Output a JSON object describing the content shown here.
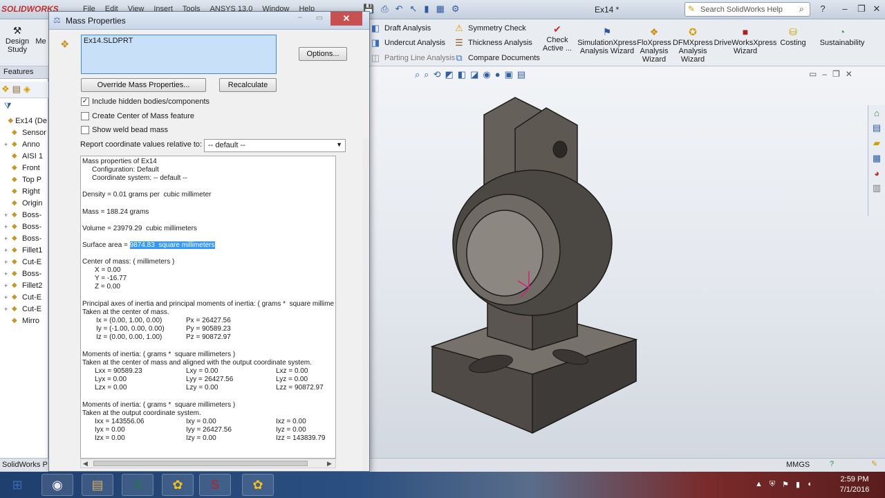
{
  "titlebar": {
    "logo": "SOLIDWORKS",
    "menus": [
      "File",
      "Edit",
      "View",
      "Insert",
      "Tools",
      "ANSYS 13.0",
      "Window",
      "Help"
    ],
    "document_title": "Ex14 *",
    "search_placeholder": "Search SolidWorks Help"
  },
  "cmdbar": {
    "design_study": "Design Study",
    "stub": "Me",
    "small_left": [
      {
        "label": "Draft Analysis",
        "icon": "draft-analysis-icon"
      },
      {
        "label": "Undercut Analysis",
        "icon": "undercut-analysis-icon"
      },
      {
        "label": "Parting Line Analysis",
        "icon": "parting-line-icon"
      }
    ],
    "small_right": [
      {
        "label": "Symmetry Check",
        "icon": "symmetry-check-icon"
      },
      {
        "label": "Thickness Analysis",
        "icon": "thickness-analysis-icon"
      },
      {
        "label": "Compare Documents",
        "icon": "compare-documents-icon"
      }
    ],
    "check_active": "Check Active ...",
    "big": [
      {
        "label": "SimulationXpress Analysis Wizard",
        "icon": "simulationxpress-icon"
      },
      {
        "label": "FloXpress Analysis Wizard",
        "icon": "floxpress-icon"
      },
      {
        "label": "DFMXpress Analysis Wizard",
        "icon": "dfmxpress-icon"
      },
      {
        "label": "DriveWorksXpress Wizard",
        "icon": "driveworksxpress-icon"
      },
      {
        "label": "Costing",
        "icon": "costing-icon"
      },
      {
        "label": "Sustainability",
        "icon": "sustainability-icon"
      }
    ]
  },
  "feature_tree": {
    "tab": "Features",
    "items": [
      {
        "label": "Ex14 (De",
        "pm": ""
      },
      {
        "label": "Sensor",
        "pm": ""
      },
      {
        "label": "Anno",
        "pm": "+"
      },
      {
        "label": "AISI 1",
        "pm": ""
      },
      {
        "label": "Front",
        "pm": ""
      },
      {
        "label": "Top P",
        "pm": ""
      },
      {
        "label": "Right",
        "pm": ""
      },
      {
        "label": "Origin",
        "pm": ""
      },
      {
        "label": "Boss-",
        "pm": "+"
      },
      {
        "label": "Boss-",
        "pm": "+"
      },
      {
        "label": "Boss-",
        "pm": "+"
      },
      {
        "label": "Fillet1",
        "pm": "+"
      },
      {
        "label": "Cut-E",
        "pm": "+"
      },
      {
        "label": "Boss-",
        "pm": "+"
      },
      {
        "label": "Fillet2",
        "pm": "+"
      },
      {
        "label": "Cut-E",
        "pm": "+"
      },
      {
        "label": "Cut-E",
        "pm": "+"
      },
      {
        "label": "Mirro",
        "pm": ""
      }
    ]
  },
  "dialog": {
    "title": "Mass Properties",
    "selected_file": "Ex14.SLDPRT",
    "options_button": "Options...",
    "override_button": "Override Mass Properties...",
    "recalculate_button": "Recalculate",
    "checkboxes": [
      {
        "label": "Include hidden bodies/components",
        "checked": "✓"
      },
      {
        "label": "Create Center of Mass feature",
        "checked": ""
      },
      {
        "label": "Show weld bead mass",
        "checked": ""
      }
    ],
    "coord_label": "Report coordinate values relative to:",
    "coord_value": "-- default --",
    "report": {
      "header": "Mass properties of Ex14",
      "configuration": "Configuration: Default",
      "coordinate_system": "Coordinate system: -- default --",
      "density": "Density = 0.01 grams per  cubic millimeter",
      "mass": "Mass = 188.24 grams",
      "volume": "Volume = 23979.29  cubic millimeters",
      "surface_prefix": "Surface area = ",
      "surface_value": "9874.83  square millimeters",
      "com_header": "Center of mass: ( millimeters )",
      "com": [
        "X = 0.00",
        "Y = -16.77",
        "Z = 0.00"
      ],
      "pa_header": "Principal axes of inertia and principal moments of inertia: ( grams *  square millime",
      "pa_sub": "Taken at the center of mass.",
      "pa_axes": [
        "Ix = (0.00, 1.00, 0.00)",
        "Iy = (-1.00, 0.00, 0.00)",
        "Iz = (0.00, 0.00, 1.00)"
      ],
      "pa_moments": [
        "Px = 26427.56",
        "Py = 90589.23",
        "Pz = 90872.97"
      ],
      "moi1_header": "Moments of inertia: ( grams *  square millimeters )",
      "moi1_sub": "Taken at the center of mass and aligned with the output coordinate system.",
      "moi1": [
        [
          "Lxx = 90589.23",
          "Lxy = 0.00",
          "Lxz = 0.00"
        ],
        [
          "Lyx = 0.00",
          "Lyy = 26427.56",
          "Lyz = 0.00"
        ],
        [
          "Lzx = 0.00",
          "Lzy = 0.00",
          "Lzz = 90872.97"
        ]
      ],
      "moi2_header": "Moments of inertia: ( grams *  square millimeters )",
      "moi2_sub": "Taken at the output coordinate system.",
      "moi2": [
        [
          "Ixx = 143556.06",
          "Ixy = 0.00",
          "Ixz = 0.00"
        ],
        [
          "Iyx = 0.00",
          "Iyy = 26427.56",
          "Iyz = 0.00"
        ],
        [
          "Izx = 0.00",
          "Izy = 0.00",
          "Izz = 143839.79"
        ]
      ]
    }
  },
  "statusbar": {
    "left": "SolidWorks P",
    "units": "MMGS"
  },
  "taskbar": {
    "apps": [
      {
        "name": "start-button",
        "glyph": "⊞"
      },
      {
        "name": "chrome-app",
        "glyph": "◉"
      },
      {
        "name": "explorer-app",
        "glyph": "▤"
      },
      {
        "name": "excel-app",
        "glyph": "X"
      },
      {
        "name": "solidworks-app-1",
        "glyph": "✿"
      },
      {
        "name": "solidworks-app-2",
        "glyph": "S"
      },
      {
        "name": "solidworks-app-3",
        "glyph": "✿"
      }
    ],
    "time": "2:59 PM",
    "date": "7/1/2016"
  }
}
